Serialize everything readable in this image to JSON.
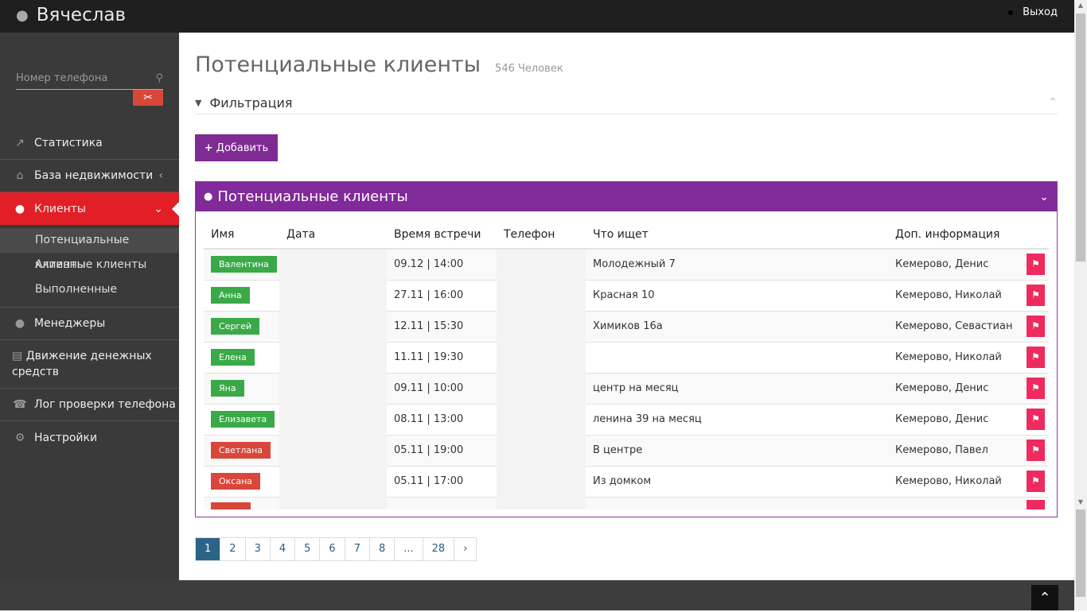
{
  "header": {
    "user": "Вячеслав",
    "logout": "Выход"
  },
  "sidebar": {
    "search_placeholder": "Номер телефона",
    "items": [
      {
        "label": "Статистика",
        "icon": "chart-line-icon"
      },
      {
        "label": "База недвижимости",
        "icon": "bank-icon"
      },
      {
        "label": "Клиенты",
        "icon": "users-icon"
      },
      {
        "label": "Менеджеры",
        "icon": "user-icon"
      },
      {
        "label": "Движение денежных средств",
        "icon": "credit-card-icon"
      },
      {
        "label": "Лог проверки телефона",
        "icon": "phone-icon"
      },
      {
        "label": "Настройки",
        "icon": "gear-icon"
      }
    ],
    "subitems": [
      "Потенциальные клиенты",
      "Активные клиенты",
      "Выполненные"
    ]
  },
  "main": {
    "title": "Потенциальные клиенты",
    "count": "546 Человек",
    "filter": "Фильтрация",
    "add": "Добавить",
    "panel_title": "Потенциальные клиенты",
    "columns": [
      "Имя",
      "Дата",
      "Время встречи",
      "Телефон",
      "Что ищет",
      "Доп. информация"
    ],
    "colors": {
      "green": "#3aaa48",
      "red": "#d9473a",
      "purple": "#812a99",
      "pink": "#ee2a5e"
    },
    "rows": [
      {
        "name": "Валентина",
        "status": "green",
        "time": "09.12 | 14:00",
        "seek": "Молодежный 7",
        "info": "Кемерово, Денис"
      },
      {
        "name": "Анна",
        "status": "green",
        "time": "27.11 | 16:00",
        "seek": "Красная 10",
        "info": "Кемерово, Николай"
      },
      {
        "name": "Сергей",
        "status": "green",
        "time": "12.11 | 15:30",
        "seek": "Химиков 16а",
        "info": "Кемерово, Севастиан"
      },
      {
        "name": "Елена",
        "status": "green",
        "time": "11.11 | 19:30",
        "seek": "",
        "info": "Кемерово, Николай"
      },
      {
        "name": "Яна",
        "status": "green",
        "time": "09.11 | 10:00",
        "seek": "центр на месяц",
        "info": "Кемерово, Денис"
      },
      {
        "name": "Елизавета",
        "status": "green",
        "time": "08.11 | 13:00",
        "seek": "ленина 39 на месяц",
        "info": "Кемерово, Денис"
      },
      {
        "name": "Светлана",
        "status": "red",
        "time": "05.11 | 19:00",
        "seek": "В центре",
        "info": "Кемерово, Павел"
      },
      {
        "name": "Оксана",
        "status": "red",
        "time": "05.11 | 17:00",
        "seek": "Из домком",
        "info": "Кемерово, Николай"
      }
    ]
  },
  "pagination": {
    "pages": [
      "1",
      "2",
      "3",
      "4",
      "5",
      "6",
      "7",
      "8",
      "...",
      "28"
    ],
    "current": "1",
    "next": "›"
  }
}
